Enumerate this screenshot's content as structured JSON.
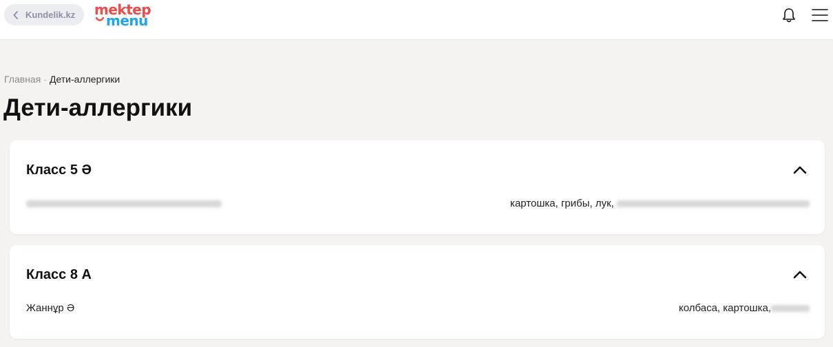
{
  "header": {
    "back_label": "Kundelik.kz",
    "logo_line1": "mektep",
    "logo_line2": "menu",
    "icons": {
      "back": "chevron-left-icon",
      "notifications": "bell-icon",
      "menu": "hamburger-menu-icon"
    }
  },
  "breadcrumb": {
    "home": "Главная",
    "separator": "-",
    "current": "Дети-аллергики"
  },
  "page": {
    "title": "Дети-аллергики"
  },
  "classes": [
    {
      "title": "Класс 5 Ә",
      "students": [
        {
          "name": "",
          "allergens": "картошка, грибы, лук,"
        }
      ]
    },
    {
      "title": "Класс 8 А",
      "students": [
        {
          "name": "Жаннұр Ә",
          "allergens": "колбаса, картошка,"
        }
      ]
    }
  ],
  "colors": {
    "background": "#f4f3ef",
    "card": "#ffffff",
    "logo_red": "#ef4a4a",
    "logo_blue": "#1ea7e6",
    "back_button_bg": "#ecedf1",
    "back_button_text": "#8c90a8"
  }
}
